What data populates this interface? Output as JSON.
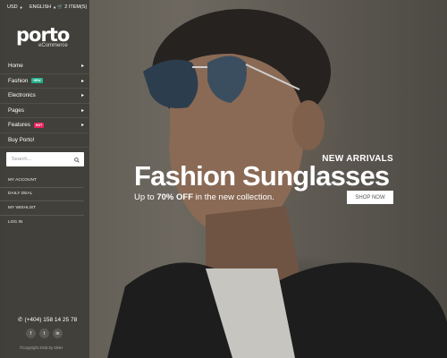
{
  "topbar": {
    "currency": "USD",
    "language": "ENGLISH",
    "cart": "2 ITEM(S)"
  },
  "logo": {
    "name": "porto",
    "tagline": "eCommerce"
  },
  "nav": [
    {
      "label": "Home",
      "badge": "",
      "badge_color": ""
    },
    {
      "label": "Fashion",
      "badge": "NEW",
      "badge_color": "#21b08a"
    },
    {
      "label": "Electronics",
      "badge": "",
      "badge_color": ""
    },
    {
      "label": "Pages",
      "badge": "",
      "badge_color": ""
    },
    {
      "label": "Features",
      "badge": "HOT",
      "badge_color": "#e8245b"
    },
    {
      "label": "Buy Porto!",
      "badge": "",
      "badge_color": ""
    }
  ],
  "search": {
    "placeholder": "Search..."
  },
  "account_links": [
    "MY ACCOUNT",
    "DAILY DEAL",
    "MY WISHLIST",
    "LOG IN"
  ],
  "contact": {
    "phone": "(+404) 158 14 25 78"
  },
  "social": [
    "f",
    "t",
    "in"
  ],
  "copyright": "©Copyright 2016 by Okler",
  "hero": {
    "subtitle": "NEW ARRIVALS",
    "title": "Fashion Sunglasses",
    "tagline_prefix": "Up to ",
    "tagline_highlight": "70% OFF",
    "tagline_suffix": " in the new collection.",
    "button": "SHOP NOW"
  }
}
